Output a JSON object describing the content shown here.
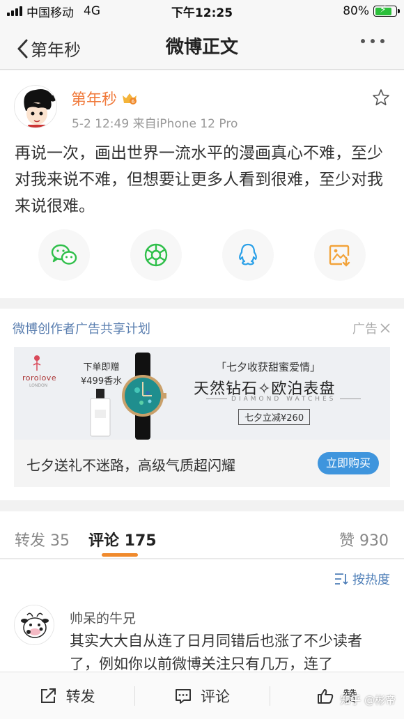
{
  "status_bar": {
    "carrier": "中国移动",
    "network": "4G",
    "time": "下午12:25",
    "battery_percent": "80%",
    "battery_level": 0.8
  },
  "nav": {
    "back_label": "第年秒",
    "title": "微博正文"
  },
  "post": {
    "author": "第年秒",
    "meta": "5-2 12:49  来自iPhone 12 Pro",
    "text": "再说一次，画出世界一流水平的漫画真心不难，至少对我来说不难，但想要让更多人看到很难，至少对我来说很难。",
    "share_icons": [
      "wechat-icon",
      "moments-icon",
      "qq-icon",
      "save-image-icon"
    ]
  },
  "ad": {
    "plan_label": "微博创作者广告共享计划",
    "ad_tag": "广告",
    "banner": {
      "brand": "rorolove",
      "brand_sub": "LONDON",
      "perfume_line1": "下单即赠",
      "perfume_line2": "¥499香水",
      "headline1": "「七夕收获甜蜜爱情」",
      "headline2": "天然钻石✧欧泊表盘",
      "headline3": "DIAMOND WATCHES",
      "headline4": "七夕立减¥260"
    },
    "slogan": "七夕送礼不迷路，高级气质超闪耀",
    "button": "立即购买"
  },
  "tabs": {
    "repost": "转发 35",
    "comment": "评论 175",
    "like": "赞 930"
  },
  "comments": {
    "sort_label": "按热度",
    "items": [
      {
        "name": "帅呆的牛兄",
        "text": "其实大大自从连了日月同错后也涨了不少读者了，例如你以前微博关注只有几万，连了"
      }
    ]
  },
  "toolbar": {
    "repost": "转发",
    "comment": "评论",
    "like": "赞"
  },
  "watermark": "知乎 @彬帝",
  "colors": {
    "author_orange": "#f0793a",
    "link_blue": "#4f7fb8",
    "button_blue": "#3f95dd",
    "tab_underline": "#f08a2c",
    "wechat_green": "#2fbf4a",
    "qq_blue": "#2aa0e8",
    "save_orange": "#f2a33a"
  }
}
